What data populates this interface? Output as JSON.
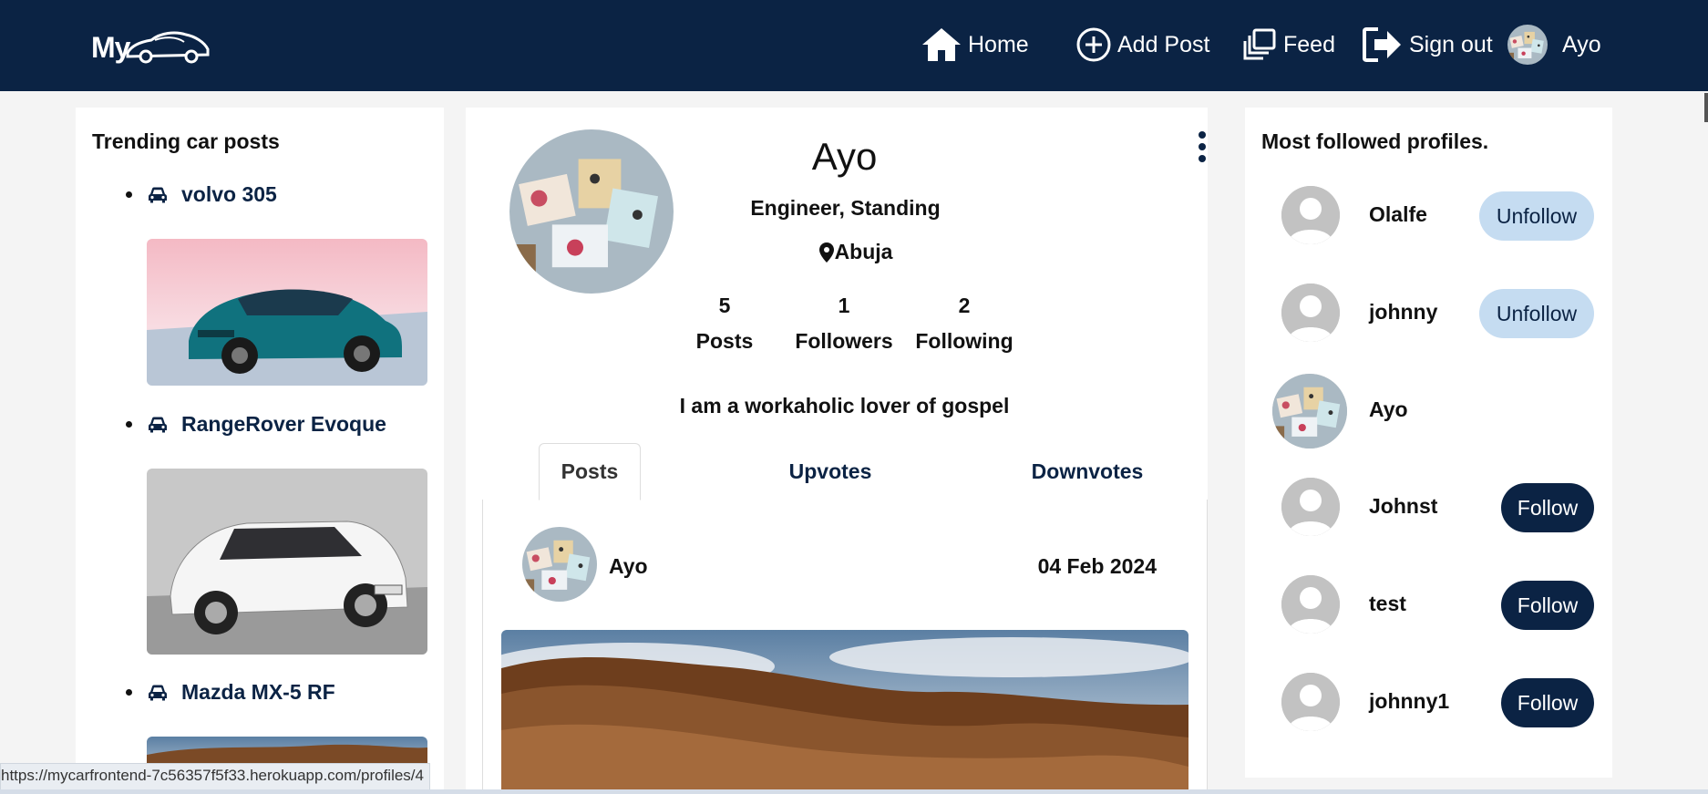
{
  "nav": {
    "logo_text": "My",
    "items": [
      {
        "label": "Home",
        "icon": "home-icon"
      },
      {
        "label": "Add Post",
        "icon": "plus-circle-icon"
      },
      {
        "label": "Feed",
        "icon": "feed-icon"
      },
      {
        "label": "Sign out",
        "icon": "sign-out-icon"
      },
      {
        "label": "Ayo",
        "icon": "avatar"
      }
    ],
    "colors": {
      "navbar": "#0b2344"
    }
  },
  "trending": {
    "heading": "Trending car posts",
    "items": [
      {
        "title": "volvo 305",
        "icon": "car-icon"
      },
      {
        "title": "RangeRover Evoque",
        "icon": "car-icon"
      },
      {
        "title": "Mazda MX-5 RF",
        "icon": "car-icon"
      }
    ]
  },
  "profile": {
    "name": "Ayo",
    "occupation": "Engineer, Standing",
    "location": "Abuja",
    "stats": [
      {
        "value": "5",
        "label": "Posts"
      },
      {
        "value": "1",
        "label": "Followers"
      },
      {
        "value": "2",
        "label": "Following"
      }
    ],
    "bio": "I am a workaholic lover of gospel",
    "tabs": [
      "Posts",
      "Upvotes",
      "Downvotes"
    ],
    "active_tab": "Posts"
  },
  "post": {
    "author": "Ayo",
    "date": "04 Feb 2024"
  },
  "most_followed": {
    "heading": "Most followed profiles.",
    "profiles": [
      {
        "name": "Olalfe",
        "action": "Unfollow"
      },
      {
        "name": "johnny",
        "action": "Unfollow"
      },
      {
        "name": "Ayo",
        "action": ""
      },
      {
        "name": "Johnst",
        "action": "Follow"
      },
      {
        "name": "test",
        "action": "Follow"
      },
      {
        "name": "johnny1",
        "action": "Follow"
      }
    ]
  },
  "status_bar": {
    "url": "https://mycarfrontend-7c56357f5f33.herokuapp.com/profiles/4"
  }
}
